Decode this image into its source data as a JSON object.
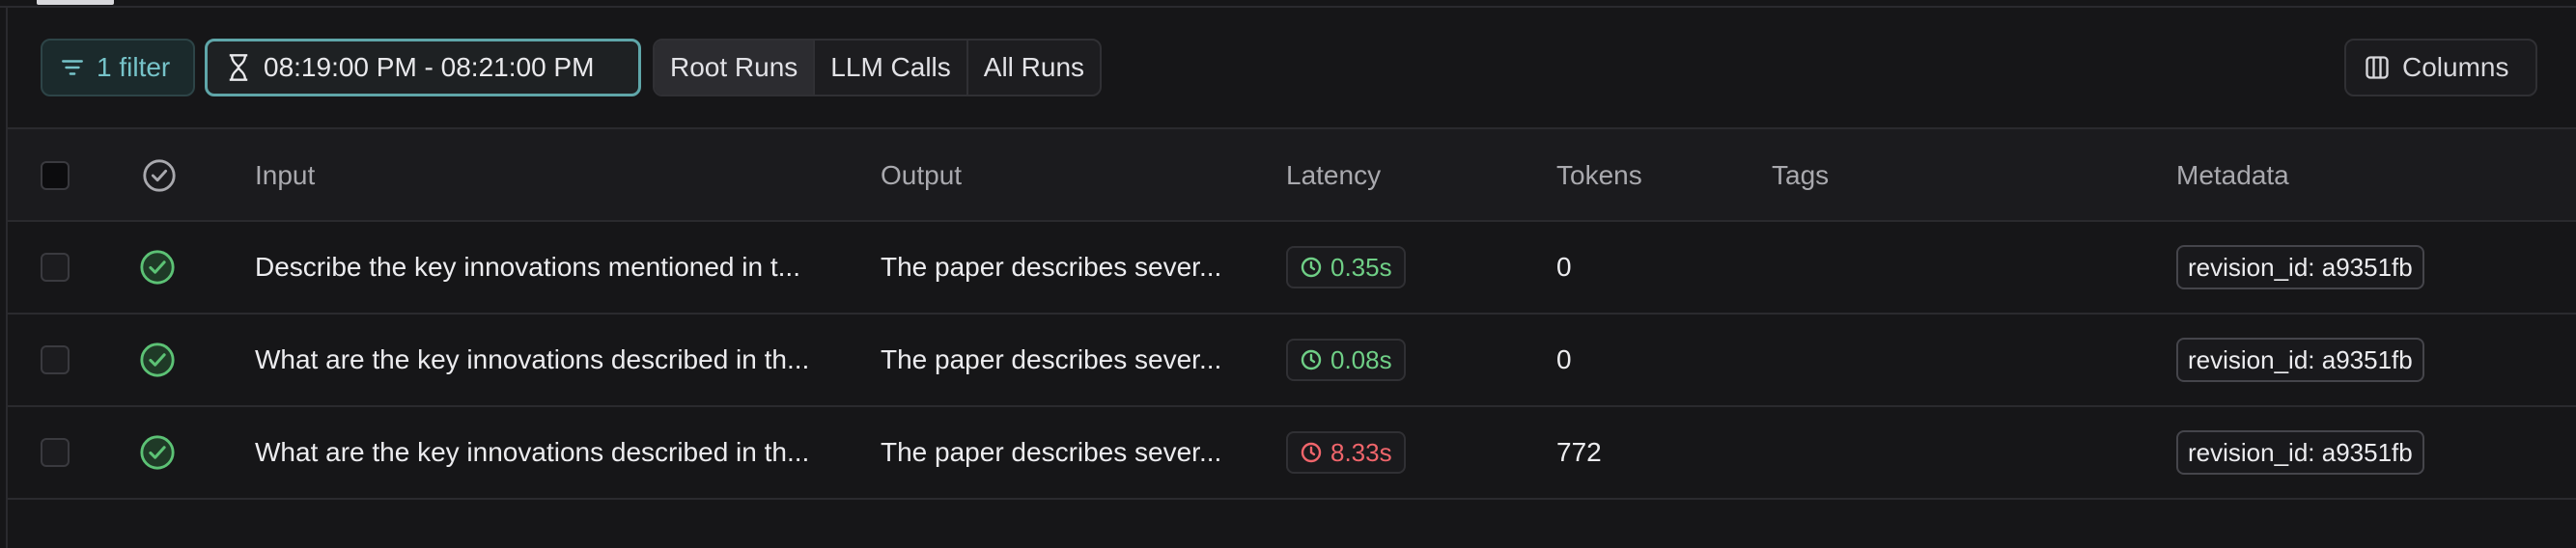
{
  "toolbar": {
    "filter_label": "1 filter",
    "time_range": "08:19:00 PM - 08:21:00 PM",
    "run_types": [
      {
        "label": "Root Runs",
        "active": true
      },
      {
        "label": "LLM Calls",
        "active": false
      },
      {
        "label": "All Runs",
        "active": false
      }
    ],
    "columns_label": "Columns"
  },
  "table": {
    "headers": {
      "input": "Input",
      "output": "Output",
      "latency": "Latency",
      "tokens": "Tokens",
      "tags": "Tags",
      "metadata": "Metadata"
    },
    "rows": [
      {
        "status": "success",
        "input": "Describe the key innovations mentioned in t...",
        "output": "The paper describes sever...",
        "latency": "0.35s",
        "latency_status": "green",
        "tokens": "0",
        "tags": "",
        "metadata": "revision_id: a9351fb"
      },
      {
        "status": "success",
        "input": "What are the key innovations described in th...",
        "output": "The paper describes sever...",
        "latency": "0.08s",
        "latency_status": "green",
        "tokens": "0",
        "tags": "",
        "metadata": "revision_id: a9351fb"
      },
      {
        "status": "success",
        "input": "What are the key innovations described in th...",
        "output": "The paper describes sever...",
        "latency": "8.33s",
        "latency_status": "red",
        "tokens": "772",
        "tags": "",
        "metadata": "revision_id: a9351fb"
      }
    ]
  },
  "colors": {
    "success": "#5cc275",
    "latency_ok": "#6fcf86",
    "latency_slow": "#f0656b",
    "accent": "#5fa6a9"
  },
  "icons": {
    "filter": "filter-icon",
    "time": "hourglass-icon",
    "columns": "columns-icon",
    "status": "check-circle-icon",
    "latency": "clock-icon"
  }
}
